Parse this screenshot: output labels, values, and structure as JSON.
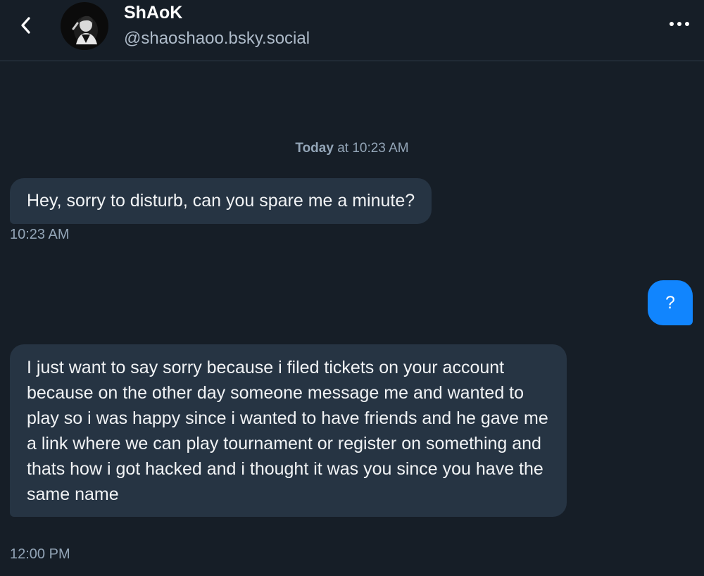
{
  "header": {
    "display_name": "ShAoK",
    "handle": "@shaoshaoo.bsky.social",
    "back_icon": "chevron-left-icon",
    "more_icon": "ellipsis-icon"
  },
  "conversation": {
    "date_separator": {
      "day": "Today",
      "time": "at 10:23 AM"
    },
    "messages": [
      {
        "sender": "them",
        "text": "Hey, sorry to disturb, can you spare me a minute?",
        "time": "10:23 AM"
      },
      {
        "sender": "me",
        "text": "?"
      },
      {
        "sender": "them",
        "text": "I just want to say sorry because i filed tickets on your account because on the other day someone message me and wanted to play so i was happy since i wanted to have friends and he gave me a link where we can play tournament or register on something and thats how i got hacked and i thought it was you since you have the same name",
        "time": "12:00 PM"
      }
    ]
  },
  "colors": {
    "background": "#161e27",
    "incoming_bubble": "#263443",
    "outgoing_bubble": "#1185fe",
    "muted_text": "#93a5b7"
  }
}
